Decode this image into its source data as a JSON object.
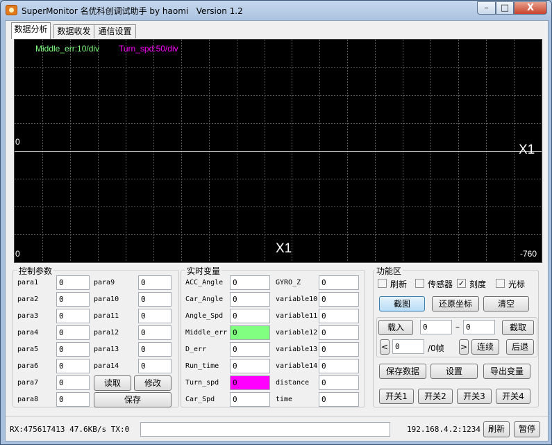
{
  "window": {
    "title": "SuperMonitor 名优科创调试助手 by haomi   Version 1.2",
    "min": "–",
    "max": "□",
    "close": "X"
  },
  "tabs": [
    "数据分析",
    "数据收发",
    "通信设置"
  ],
  "scope": {
    "legend": [
      {
        "text": "Middle_err:10/div",
        "color": "#7fff7f"
      },
      {
        "text": "Turn_spd:50/div",
        "color": "#ff00ff"
      }
    ],
    "y_zero_label": "0",
    "y_bottom_label": "0",
    "x_axis_label": "X1",
    "right_axis_label": "X1",
    "x_end_label": "-760",
    "grid_color": "#5a5a5a",
    "axis_color": "#ffffff",
    "background": "#000000"
  },
  "control_params": {
    "title": "控制参数",
    "left": [
      {
        "label": "para1",
        "value": "0"
      },
      {
        "label": "para2",
        "value": "0"
      },
      {
        "label": "para3",
        "value": "0"
      },
      {
        "label": "para4",
        "value": "0"
      },
      {
        "label": "para5",
        "value": "0"
      },
      {
        "label": "para6",
        "value": "0"
      },
      {
        "label": "para7",
        "value": "0"
      },
      {
        "label": "para8",
        "value": "0"
      }
    ],
    "right": [
      {
        "label": "para9",
        "value": "0"
      },
      {
        "label": "para10",
        "value": "0"
      },
      {
        "label": "para11",
        "value": "0"
      },
      {
        "label": "para12",
        "value": "0"
      },
      {
        "label": "para13",
        "value": "0"
      },
      {
        "label": "para14",
        "value": "0"
      }
    ],
    "read_button": "读取",
    "modify_button": "修改",
    "save_button": "保存"
  },
  "realtime_vars": {
    "title": "实时变量",
    "left": [
      {
        "label": "ACC_Angle",
        "value": "0",
        "color": ""
      },
      {
        "label": "Car_Angle",
        "value": "0",
        "color": ""
      },
      {
        "label": "Angle_Spd",
        "value": "0",
        "color": ""
      },
      {
        "label": "Middle_err",
        "value": "0",
        "color": "#80ff80"
      },
      {
        "label": "D_err",
        "value": "0",
        "color": ""
      },
      {
        "label": "Run_time",
        "value": "0",
        "color": ""
      },
      {
        "label": "Turn_spd",
        "value": "0",
        "color": "#ff00ff"
      },
      {
        "label": "Car_Spd",
        "value": "0",
        "color": ""
      }
    ],
    "right": [
      {
        "label": "GYRO_Z",
        "value": "0"
      },
      {
        "label": "variable10",
        "value": "0"
      },
      {
        "label": "variable11",
        "value": "0"
      },
      {
        "label": "variable12",
        "value": "0"
      },
      {
        "label": "variable13",
        "value": "0"
      },
      {
        "label": "variable14",
        "value": "0"
      },
      {
        "label": "distance",
        "value": "0"
      },
      {
        "label": "time",
        "value": "0"
      }
    ]
  },
  "functions": {
    "title": "功能区",
    "checks": [
      {
        "label": "刷新",
        "checked": false
      },
      {
        "label": "传感器",
        "checked": false
      },
      {
        "label": "刻度",
        "checked": true
      },
      {
        "label": "光标",
        "checked": false
      }
    ],
    "screenshot_button": "截图",
    "restore_button": "还原坐标",
    "clear_button": "清空",
    "load_button": "载入",
    "range_from": "0",
    "range_dash": "–",
    "range_to": "0",
    "capture_button": "截取",
    "prev_button": "<",
    "frame_value": "0",
    "frame_unit": "/0帧",
    "next_button": ">",
    "play_button": "连续",
    "back_button": "后退",
    "save_data_button": "保存数据",
    "settings_button": "设置",
    "export_button": "导出变量",
    "switches": [
      "开关1",
      "开关2",
      "开关3",
      "开关4"
    ]
  },
  "status": {
    "rx_text": "RX:475617413 47.6KB/s TX:0",
    "message": "",
    "address": "192.168.4.2:1234",
    "refresh_button": "刷新",
    "pause_button": "暂停"
  }
}
